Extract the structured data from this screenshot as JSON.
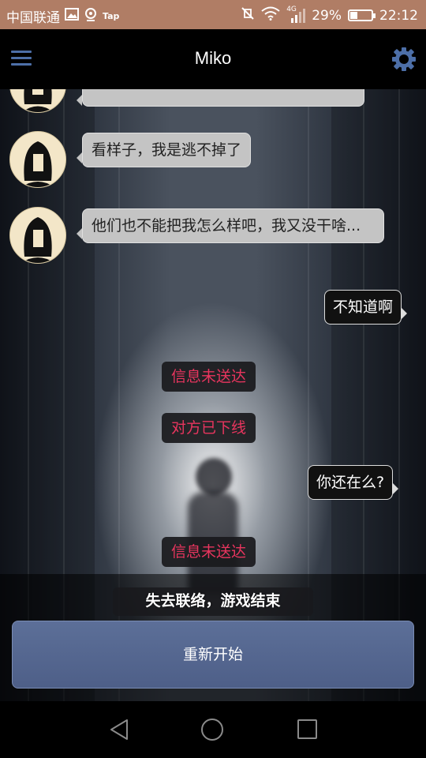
{
  "status_bar": {
    "carrier": "中国联通",
    "tap_label": "Tap",
    "network": "4G",
    "battery": "29%",
    "time": "22:12"
  },
  "header": {
    "title": "Miko",
    "menu_icon": "hamburger-menu-icon",
    "settings_icon": "gear-icon"
  },
  "messages": [
    {
      "from": "miko",
      "text": "看样子，我是逃不掉了"
    },
    {
      "from": "miko",
      "text": "他们也不能把我怎么样吧，我又没干啥..."
    },
    {
      "from": "me",
      "text": "不知道啊"
    },
    {
      "from": "system",
      "text": "信息未送达"
    },
    {
      "from": "system",
      "text": "对方已下线"
    },
    {
      "from": "me",
      "text": "你还在么?"
    },
    {
      "from": "system",
      "text": "信息未送达"
    }
  ],
  "game_over": {
    "message": "失去联络，游戏结束",
    "restart_label": "重新开始"
  },
  "colors": {
    "status_bar": "#b07d65",
    "accent": "#4d6fa8",
    "system_text": "#e8355e",
    "restart_button": "#56688f"
  }
}
